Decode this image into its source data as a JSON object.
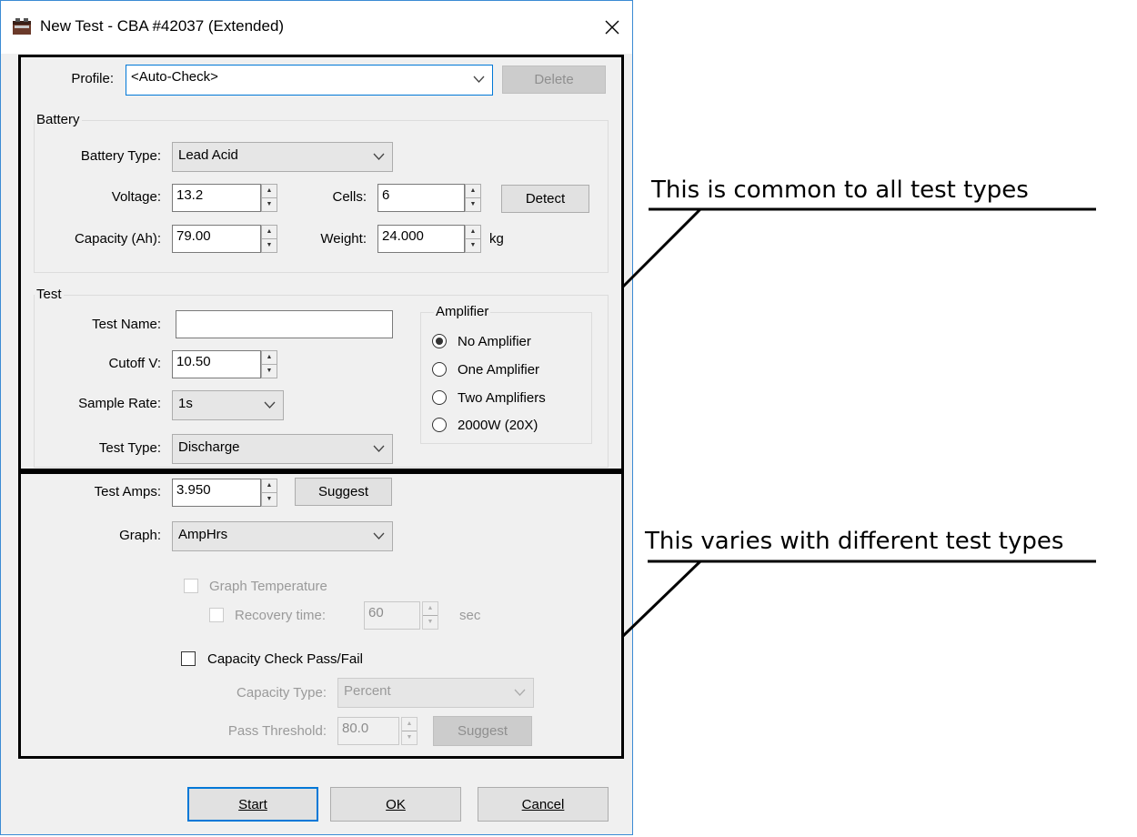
{
  "window": {
    "title": "New Test - CBA #42037 (Extended)"
  },
  "profile": {
    "label": "Profile:",
    "value": "<Auto-Check>",
    "delete_label": "Delete"
  },
  "battery": {
    "group_label": "Battery",
    "type_label": "Battery Type:",
    "type_value": "Lead Acid",
    "voltage_label": "Voltage:",
    "voltage_value": "13.2",
    "cells_label": "Cells:",
    "cells_value": "6",
    "detect_label": "Detect",
    "capacity_label": "Capacity (Ah):",
    "capacity_value": "79.00",
    "weight_label": "Weight:",
    "weight_value": "24.000",
    "weight_unit": "kg"
  },
  "test": {
    "group_label": "Test",
    "name_label": "Test Name:",
    "name_value": "",
    "cutoff_label": "Cutoff V:",
    "cutoff_value": "10.50",
    "sample_label": "Sample Rate:",
    "sample_value": "1s",
    "type_label": "Test Type:",
    "type_value": "Discharge",
    "amplifier": {
      "group_label": "Amplifier",
      "options": [
        "No Amplifier",
        "One Amplifier",
        "Two Amplifiers",
        "2000W (20X)"
      ],
      "selected": "No Amplifier"
    }
  },
  "details": {
    "amps_label": "Test Amps:",
    "amps_value": "3.950",
    "suggest_label": "Suggest",
    "graph_label": "Graph:",
    "graph_value": "AmpHrs",
    "graph_temp_label": "Graph Temperature",
    "recovery_label": "Recovery time:",
    "recovery_value": "60",
    "recovery_unit": "sec",
    "capcheck_label": "Capacity Check Pass/Fail",
    "captype_label": "Capacity Type:",
    "captype_value": "Percent",
    "threshold_label": "Pass Threshold:",
    "threshold_value": "80.0",
    "threshold_suggest_label": "Suggest"
  },
  "buttons": {
    "start": "Start",
    "ok": "OK",
    "cancel": "Cancel"
  },
  "annotations": {
    "common": "This is common to all test types",
    "varies": "This varies with different test types"
  }
}
